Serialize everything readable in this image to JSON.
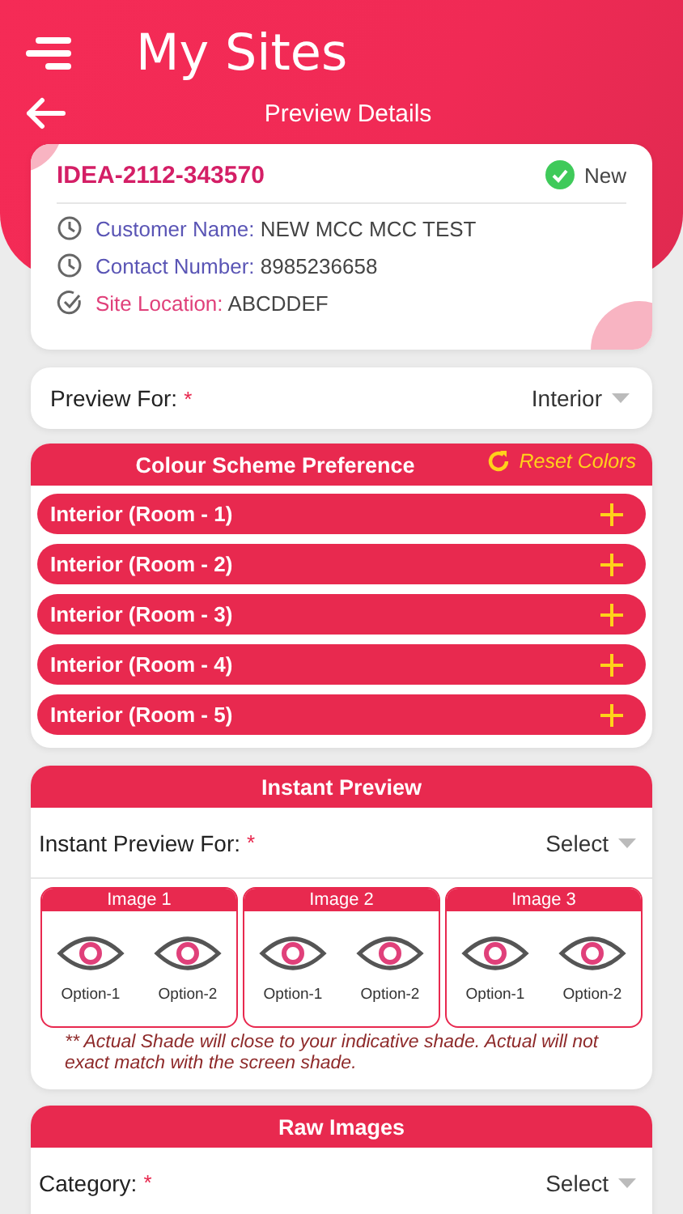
{
  "header": {
    "title": "My Sites",
    "subtitle": "Preview Details"
  },
  "site": {
    "id": "IDEA-2112-343570",
    "status": "New",
    "fields": [
      {
        "kind": "clock",
        "label": "Customer Name:",
        "value": "NEW MCC MCC TEST",
        "color": "#5a55b5"
      },
      {
        "kind": "clock",
        "label": "Contact Number:",
        "value": "8985236658",
        "color": "#5a55b5"
      },
      {
        "kind": "check",
        "label": "Site Location:",
        "value": "ABCDDEF",
        "color": "#e0407a"
      }
    ]
  },
  "preview_for": {
    "label": "Preview For:",
    "required": "*",
    "value": "Interior"
  },
  "colour_scheme": {
    "title": "Colour Scheme Preference",
    "reset": "Reset Colors",
    "rooms": [
      "Interior (Room - 1)",
      "Interior (Room - 2)",
      "Interior (Room - 3)",
      "Interior (Room - 4)",
      "Interior (Room - 5)"
    ]
  },
  "instant_preview": {
    "title": "Instant Preview",
    "field": {
      "label": "Instant Preview For:",
      "required": "*",
      "value": "Select"
    },
    "images": [
      {
        "title": "Image 1",
        "options": [
          "Option-1",
          "Option-2"
        ]
      },
      {
        "title": "Image 2",
        "options": [
          "Option-1",
          "Option-2"
        ]
      },
      {
        "title": "Image 3",
        "options": [
          "Option-1",
          "Option-2"
        ]
      }
    ],
    "note": "** Actual Shade will close to your indicative shade. Actual will not exact match with the screen shade."
  },
  "raw_images": {
    "title": "Raw Images",
    "field": {
      "label": "Category:",
      "required": "*",
      "value": "Select"
    }
  }
}
